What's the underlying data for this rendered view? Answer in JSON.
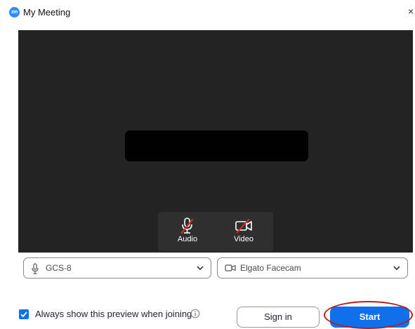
{
  "window": {
    "logo_text": "zm",
    "title": "My Meeting",
    "close_glyph": "×"
  },
  "preview": {
    "controls": {
      "audio_label": "Audio",
      "video_label": "Video",
      "audio_icon": "microphone-muted-icon",
      "video_icon": "video-camera-off-icon"
    }
  },
  "devices": {
    "microphone": {
      "value": "GCS-8",
      "icon": "microphone-icon"
    },
    "camera": {
      "value": "Elgato Facecam",
      "icon": "camera-icon"
    }
  },
  "footer": {
    "always_show_preview_label": "Always show this preview when joining",
    "always_show_preview_checked": true,
    "sign_in_label": "Sign in",
    "start_label": "Start"
  },
  "colors": {
    "accent": "#0e71eb",
    "preview_bg": "#232323",
    "muted_slash": "#e02828",
    "highlight_ring": "#b91d1d"
  }
}
